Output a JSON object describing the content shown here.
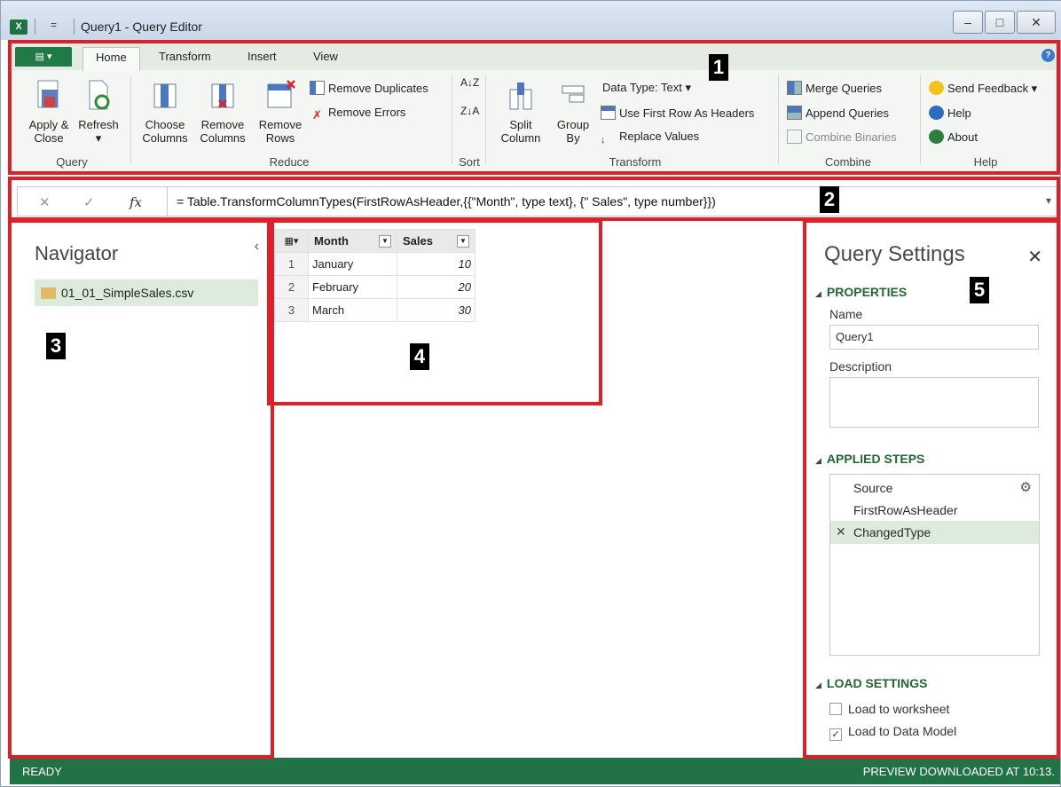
{
  "window": {
    "title": "Query1 - Query Editor",
    "app_icon": "excel-icon",
    "qat_glyph": "=",
    "buttons": {
      "minimize": "–",
      "maximize": "□",
      "close": "✕"
    }
  },
  "ribbon": {
    "file_label": "▤ ▾",
    "tabs": [
      "Home",
      "Transform",
      "Insert",
      "View"
    ],
    "active_tab": "Home",
    "help_glyph": "?",
    "query": {
      "group": "Query",
      "apply_close": "Apply & Close",
      "refresh": "Refresh",
      "refresh_dd": "▾"
    },
    "reduce": {
      "group": "Reduce",
      "choose_columns": "Choose Columns",
      "remove_columns": "Remove Columns",
      "remove_rows": "Remove Rows",
      "remove_duplicates": "Remove Duplicates",
      "remove_errors": "Remove Errors"
    },
    "sort": {
      "group": "Sort",
      "asc": "A↓Z",
      "desc": "Z↓A"
    },
    "transform": {
      "group": "Transform",
      "split_column": "Split Column",
      "group_by": "Group By",
      "data_type": "Data Type: Text ▾",
      "first_row_headers": "Use First Row As Headers",
      "replace_values": "Replace Values"
    },
    "combine": {
      "group": "Combine",
      "merge": "Merge Queries",
      "append": "Append Queries",
      "binaries": "Combine Binaries"
    },
    "help": {
      "group": "Help",
      "feedback": "Send Feedback ▾",
      "help": "Help",
      "about": "About"
    }
  },
  "formula": {
    "cancel": "✕",
    "confirm": "✓",
    "fx": "fx",
    "text": "= Table.TransformColumnTypes(FirstRowAsHeader,{{\"Month\", type text}, {\" Sales\", type number}})",
    "expand": "▾"
  },
  "navigator": {
    "title": "Navigator",
    "collapse": "‹",
    "item": "01_01_SimpleSales.csv"
  },
  "grid": {
    "corner": "▦▾",
    "columns": [
      "Month",
      "Sales"
    ],
    "rows": [
      {
        "n": "1",
        "month": "January",
        "sales": "10"
      },
      {
        "n": "2",
        "month": "February",
        "sales": "20"
      },
      {
        "n": "3",
        "month": "March",
        "sales": "30"
      }
    ]
  },
  "query_settings": {
    "title": "Query Settings",
    "close": "✕",
    "properties": "PROPERTIES",
    "name_label": "Name",
    "name_value": "Query1",
    "description_label": "Description",
    "applied_steps": "APPLIED STEPS",
    "steps": [
      "Source",
      "FirstRowAsHeader",
      "ChangedType"
    ],
    "load_settings": "LOAD SETTINGS",
    "load_worksheet": "Load to worksheet",
    "load_data_model": "Load to Data Model",
    "load_worksheet_checked": false,
    "load_data_model_checked": true
  },
  "status": {
    "left": "READY",
    "right": "PREVIEW DOWNLOADED AT 10:13."
  },
  "annotations": [
    "1",
    "2",
    "3",
    "4",
    "5"
  ],
  "colors": {
    "accent": "#217346",
    "annotation": "#e02028",
    "selection": "#dcebdc"
  }
}
